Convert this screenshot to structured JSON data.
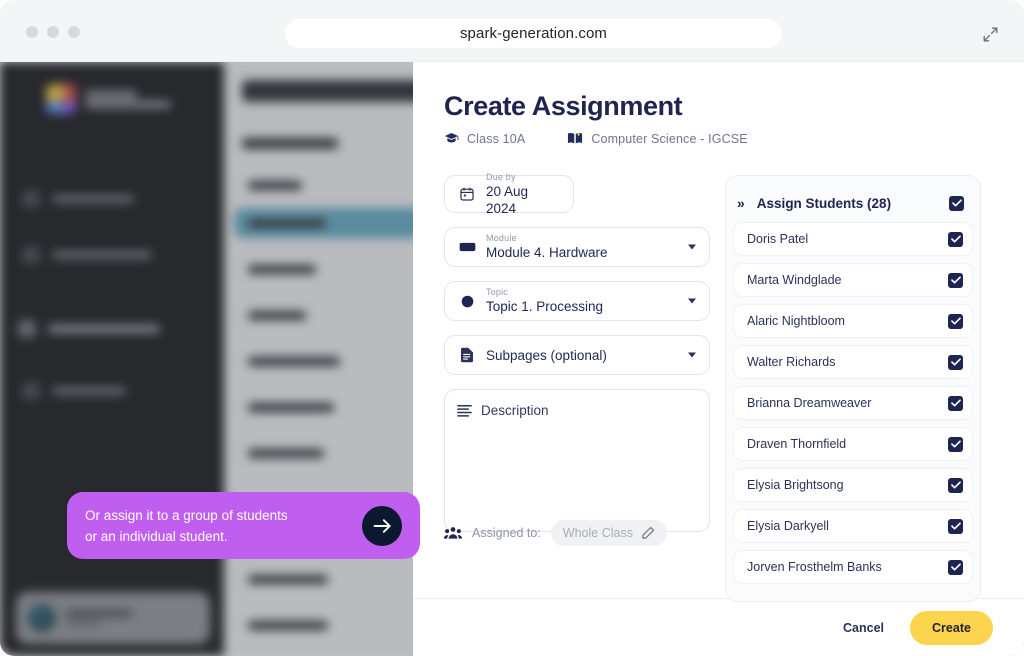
{
  "browser": {
    "url": "spark-generation.com",
    "expand_icon": "expand-diagonal-icon",
    "traffic_lights": [
      "close",
      "minimize",
      "zoom"
    ]
  },
  "modal": {
    "title": "Create Assignment",
    "meta": [
      {
        "icon": "graduation-cap-icon",
        "label": "Class 10A"
      },
      {
        "icon": "open-book-icon",
        "label": "Computer Science - IGCSE"
      }
    ],
    "fields": {
      "due": {
        "icon": "calendar-icon",
        "label": "Due by",
        "value": "20 Aug 2024"
      },
      "module": {
        "icon": "module-icon",
        "label": "Module",
        "value": "Module 4. Hardware"
      },
      "topic": {
        "icon": "topic-dot-icon",
        "label": "Topic",
        "value": "Topic 1. Processing"
      },
      "subpages": {
        "icon": "document-icon",
        "placeholder": "Subpages (optional)"
      },
      "description": {
        "icon": "lines-icon",
        "placeholder": "Description"
      }
    },
    "assigned": {
      "icon": "people-group-icon",
      "label": "Assigned to:",
      "pill_value": "Whole Class",
      "pill_icon": "pencil-icon"
    },
    "students_panel": {
      "chevron": "»",
      "title": "Assign Students (28)",
      "header_checked": true,
      "rows": [
        {
          "name": "Doris Patel",
          "checked": true
        },
        {
          "name": "Marta Windglade",
          "checked": true
        },
        {
          "name": "Alaric Nightbloom",
          "checked": true
        },
        {
          "name": "Walter Richards",
          "checked": true
        },
        {
          "name": "Brianna Dreamweaver",
          "checked": true
        },
        {
          "name": "Draven Thornfield",
          "checked": true
        },
        {
          "name": "Elysia Brightsong",
          "checked": true
        },
        {
          "name": "Elysia Darkyell",
          "checked": true
        },
        {
          "name": "Jorven Frosthelm Banks",
          "checked": true
        }
      ]
    },
    "footer": {
      "cancel_label": "Cancel",
      "create_label": "Create"
    }
  },
  "callout": {
    "line1": "Or assign it to a group of students",
    "line2": "or an individual student.",
    "next_icon": "arrow-right-icon",
    "background": "#c05ef0"
  },
  "colors": {
    "accent_navy": "#1d2550",
    "accent_yellow": "#fcd34d",
    "callout_purple": "#c05ef0",
    "chrome_gray": "#f4f5f7"
  }
}
